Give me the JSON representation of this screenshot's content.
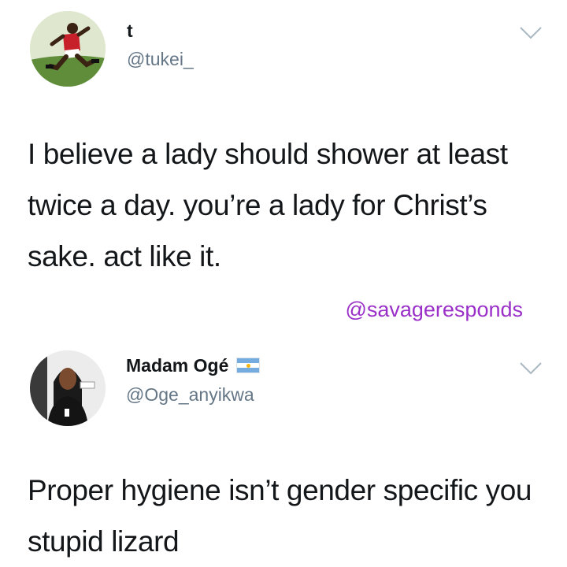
{
  "tweets": [
    {
      "display_name": "t",
      "handle": "@tukei_",
      "text": "I believe a lady should shower at least twice a day. you’re a lady for Christ’s sake. act like it.",
      "avatar_icon": "soccer-player-avatar",
      "menu_icon": "chevron-down-icon"
    },
    {
      "display_name": "Madam Ogé",
      "handle": "@Oge_anyikwa",
      "text": "Proper hygiene isn’t gender specific you stupid lizard",
      "avatar_icon": "woman-portrait-avatar",
      "flag_icon": "argentina-flag-icon",
      "menu_icon": "chevron-down-icon"
    }
  ],
  "watermark": "@savageresponds",
  "colors": {
    "text": "#14171a",
    "handle": "#657786",
    "watermark": "#9b30c9"
  }
}
